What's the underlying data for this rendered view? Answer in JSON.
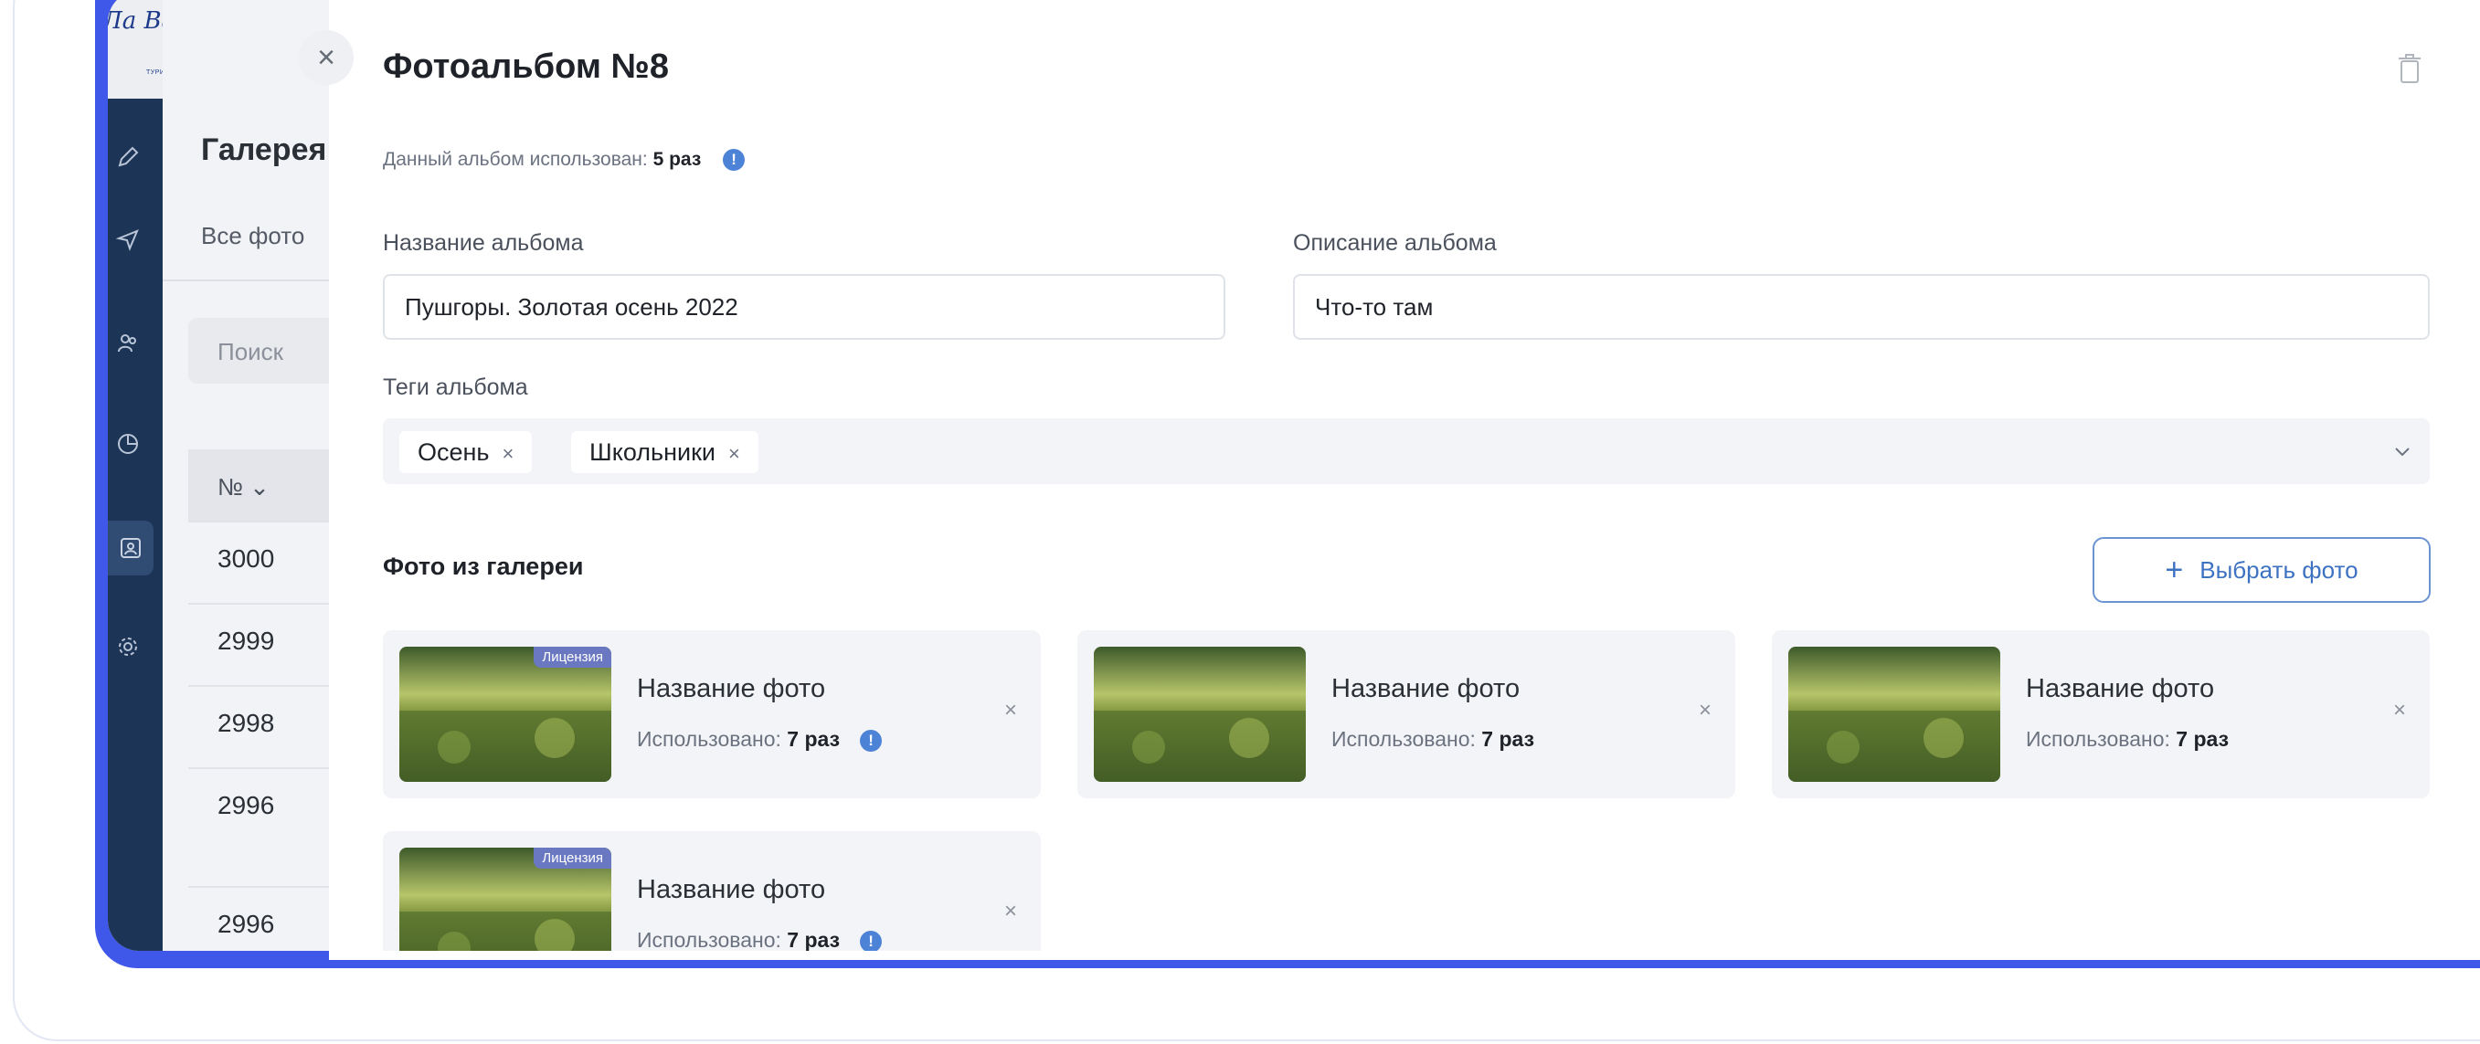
{
  "logo": {
    "text": "Ла Вареле",
    "subtitle": "ТУРИСТСКАЯ ФИРМА"
  },
  "sidebar": {
    "icons": [
      "edit-icon",
      "plane-icon",
      "users-icon",
      "chart-icon",
      "gallery-icon",
      "settings-icon"
    ],
    "active": "gallery-icon"
  },
  "background": {
    "title": "Галерея",
    "subtitle": "Все фото",
    "search_placeholder": "Поиск",
    "column_header": "№",
    "rows": [
      "3000",
      "2999",
      "2998",
      "2996",
      "2996"
    ]
  },
  "modal": {
    "title": "Фотоальбом №8",
    "usage_label": "Данный альбом использован:",
    "usage_value": "5 раз",
    "info_symbol": "!",
    "name_label": "Название альбома",
    "name_value": "Пушгоры. Золотая осень 2022",
    "description_label": "Описание альбома",
    "description_value": "Что-то там",
    "tags_label": "Теги альбома",
    "tags": [
      {
        "label": "Осень",
        "remove": "×"
      },
      {
        "label": "Школьники",
        "remove": "×"
      }
    ],
    "gallery_section_title": "Фото из галереи",
    "choose_button": {
      "icon": "+",
      "label": "Выбрать фото"
    },
    "photos": [
      {
        "badge": "Лицензия",
        "name": "Название фото",
        "used_label": "Использовано:",
        "used_value": "7 раз",
        "info": true,
        "remove": "×"
      },
      {
        "badge": "",
        "name": "Название фото",
        "used_label": "Использовано:",
        "used_value": "7 раз",
        "info": false,
        "remove": "×"
      },
      {
        "badge": "",
        "name": "Название фото",
        "used_label": "Использовано:",
        "used_value": "7 раз",
        "info": false,
        "remove": "×"
      },
      {
        "badge": "Лицензия",
        "name": "Название фото",
        "used_label": "Использовано:",
        "used_value": "7 раз",
        "info": true,
        "remove": "×"
      }
    ],
    "close_symbol": "×"
  },
  "colors": {
    "device_frame": "#3f58ea",
    "sidebar": "#1c3557",
    "accent": "#3d72c2",
    "badge": "#6a78c2",
    "info": "#4c83d7"
  }
}
